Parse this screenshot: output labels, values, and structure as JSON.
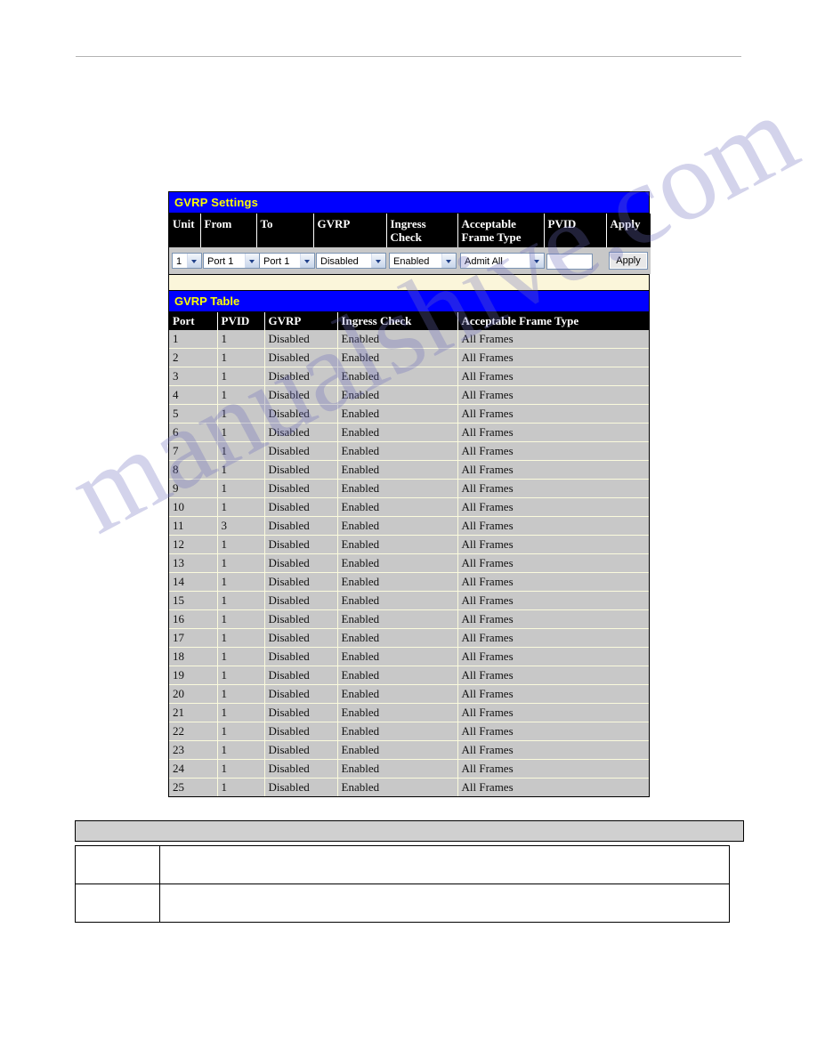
{
  "page": {
    "watermark_text": "manualshive.com",
    "accent_blue": "#0000ff",
    "accent_yellow": "#ffff00",
    "row_bg": "#c8c8c8",
    "strip_cream": "#fbf6da"
  },
  "settings_panel": {
    "title": "GVRP Settings",
    "columns": [
      "Unit",
      "From",
      "To",
      "GVRP",
      "Ingress Check",
      "Acceptable Frame Type",
      "PVID",
      "Apply"
    ],
    "fields": {
      "unit": "1",
      "from": "Port 1",
      "to": "Port 1",
      "gvrp": "Disabled",
      "ingress_check": "Enabled",
      "acceptable_frame_type": "Admit All",
      "pvid": "",
      "pvid_placeholder": ""
    },
    "apply_label": "Apply"
  },
  "gvrp_table": {
    "title": "GVRP Table",
    "columns": [
      "Port",
      "PVID",
      "GVRP",
      "Ingress Check",
      "Acceptable Frame Type"
    ],
    "rows": [
      {
        "port": "1",
        "pvid": "1",
        "gvrp": "Disabled",
        "ingress": "Enabled",
        "aft": "All Frames"
      },
      {
        "port": "2",
        "pvid": "1",
        "gvrp": "Disabled",
        "ingress": "Enabled",
        "aft": "All Frames"
      },
      {
        "port": "3",
        "pvid": "1",
        "gvrp": "Disabled",
        "ingress": "Enabled",
        "aft": "All Frames"
      },
      {
        "port": "4",
        "pvid": "1",
        "gvrp": "Disabled",
        "ingress": "Enabled",
        "aft": "All Frames"
      },
      {
        "port": "5",
        "pvid": "1",
        "gvrp": "Disabled",
        "ingress": "Enabled",
        "aft": "All Frames"
      },
      {
        "port": "6",
        "pvid": "1",
        "gvrp": "Disabled",
        "ingress": "Enabled",
        "aft": "All Frames"
      },
      {
        "port": "7",
        "pvid": "1",
        "gvrp": "Disabled",
        "ingress": "Enabled",
        "aft": "All Frames"
      },
      {
        "port": "8",
        "pvid": "1",
        "gvrp": "Disabled",
        "ingress": "Enabled",
        "aft": "All Frames"
      },
      {
        "port": "9",
        "pvid": "1",
        "gvrp": "Disabled",
        "ingress": "Enabled",
        "aft": "All Frames"
      },
      {
        "port": "10",
        "pvid": "1",
        "gvrp": "Disabled",
        "ingress": "Enabled",
        "aft": "All Frames"
      },
      {
        "port": "11",
        "pvid": "3",
        "gvrp": "Disabled",
        "ingress": "Enabled",
        "aft": "All Frames"
      },
      {
        "port": "12",
        "pvid": "1",
        "gvrp": "Disabled",
        "ingress": "Enabled",
        "aft": "All Frames"
      },
      {
        "port": "13",
        "pvid": "1",
        "gvrp": "Disabled",
        "ingress": "Enabled",
        "aft": "All Frames"
      },
      {
        "port": "14",
        "pvid": "1",
        "gvrp": "Disabled",
        "ingress": "Enabled",
        "aft": "All Frames"
      },
      {
        "port": "15",
        "pvid": "1",
        "gvrp": "Disabled",
        "ingress": "Enabled",
        "aft": "All Frames"
      },
      {
        "port": "16",
        "pvid": "1",
        "gvrp": "Disabled",
        "ingress": "Enabled",
        "aft": "All Frames"
      },
      {
        "port": "17",
        "pvid": "1",
        "gvrp": "Disabled",
        "ingress": "Enabled",
        "aft": "All Frames"
      },
      {
        "port": "18",
        "pvid": "1",
        "gvrp": "Disabled",
        "ingress": "Enabled",
        "aft": "All Frames"
      },
      {
        "port": "19",
        "pvid": "1",
        "gvrp": "Disabled",
        "ingress": "Enabled",
        "aft": "All Frames"
      },
      {
        "port": "20",
        "pvid": "1",
        "gvrp": "Disabled",
        "ingress": "Enabled",
        "aft": "All Frames"
      },
      {
        "port": "21",
        "pvid": "1",
        "gvrp": "Disabled",
        "ingress": "Enabled",
        "aft": "All Frames"
      },
      {
        "port": "22",
        "pvid": "1",
        "gvrp": "Disabled",
        "ingress": "Enabled",
        "aft": "All Frames"
      },
      {
        "port": "23",
        "pvid": "1",
        "gvrp": "Disabled",
        "ingress": "Enabled",
        "aft": "All Frames"
      },
      {
        "port": "24",
        "pvid": "1",
        "gvrp": "Disabled",
        "ingress": "Enabled",
        "aft": "All Frames"
      },
      {
        "port": "25",
        "pvid": "1",
        "gvrp": "Disabled",
        "ingress": "Enabled",
        "aft": "All Frames"
      }
    ]
  },
  "doc_tables": {
    "gray_bar_text": "",
    "param_rows": [
      {
        "label": "",
        "description": ""
      },
      {
        "label": "",
        "description": ""
      }
    ]
  }
}
